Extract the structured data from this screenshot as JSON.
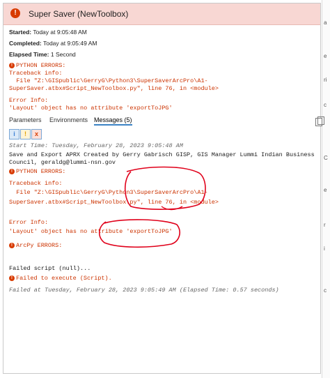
{
  "window": {
    "title": "Super Saver (NewToolbox)"
  },
  "info": {
    "started_label": "Started:",
    "started_value": "Today at 9:05:48 AM",
    "completed_label": "Completed:",
    "completed_value": "Today at 9:05:49 AM",
    "elapsed_label": "Elapsed Time:",
    "elapsed_value": "1 Second"
  },
  "summary": {
    "python_errors": "PYTHON ERRORS:",
    "traceback": "Traceback info:",
    "file_line1": "  File \"Z:\\GISpublic\\GerryG\\Python3\\SuperSaverArcPro\\A1-",
    "file_line2": "SuperSaver.atbx#Script_NewToolbox.py\", line 76, in <module>",
    "error_info": "Error Info:",
    "error_msg": "'Layout' object has no attribute 'exportToJPG'"
  },
  "tabs": [
    {
      "label": "Parameters"
    },
    {
      "label": "Environments"
    },
    {
      "label": "Messages (5)"
    }
  ],
  "filters": [
    {
      "icon": "info-icon",
      "label": "i",
      "color": "#3b7fd4"
    },
    {
      "icon": "warning-icon",
      "label": "!",
      "color": "#e0a000"
    },
    {
      "icon": "error-icon",
      "label": "x",
      "color": "#d83b01"
    }
  ],
  "messages": {
    "start_time": "Start Time: Tuesday, February 28, 2023 9:05:48 AM",
    "save_line1": "Save and Export APRX Created by Gerry Gabrisch GISP, GIS Manager Lummi Indian Business",
    "save_line2": "Council, geraldg@lummi-nsn.gov",
    "python_errors": "PYTHON ERRORS:",
    "traceback": "Traceback info:",
    "file_line1": "  File \"Z:\\GISpublic\\GerryG\\Python3\\SuperSaverArcPro\\A1-",
    "file_line2": "SuperSaver.atbx#Script_NewToolbox.py\", line 76, in <module>",
    "error_info": "Error Info:",
    "error_msg": "'Layout' object has no attribute 'exportToJPG'",
    "arcpy_errors": "ArcPy ERRORS:",
    "failed_script": "Failed script (null)...",
    "failed_execute": "Failed to execute (Script).",
    "failed_at": "Failed at Tuesday, February 28, 2023 9:05:49 AM (Elapsed Time: 0.57 seconds)"
  },
  "right_strip": [
    "a",
    "e",
    "ri",
    "c",
    "C",
    "e",
    "r",
    "i",
    "c"
  ],
  "colors": {
    "header_bg": "#f8d7d3",
    "error_text": "#cc3300",
    "annotation": "#e0001a",
    "tab_underline": "#3b82c4"
  }
}
